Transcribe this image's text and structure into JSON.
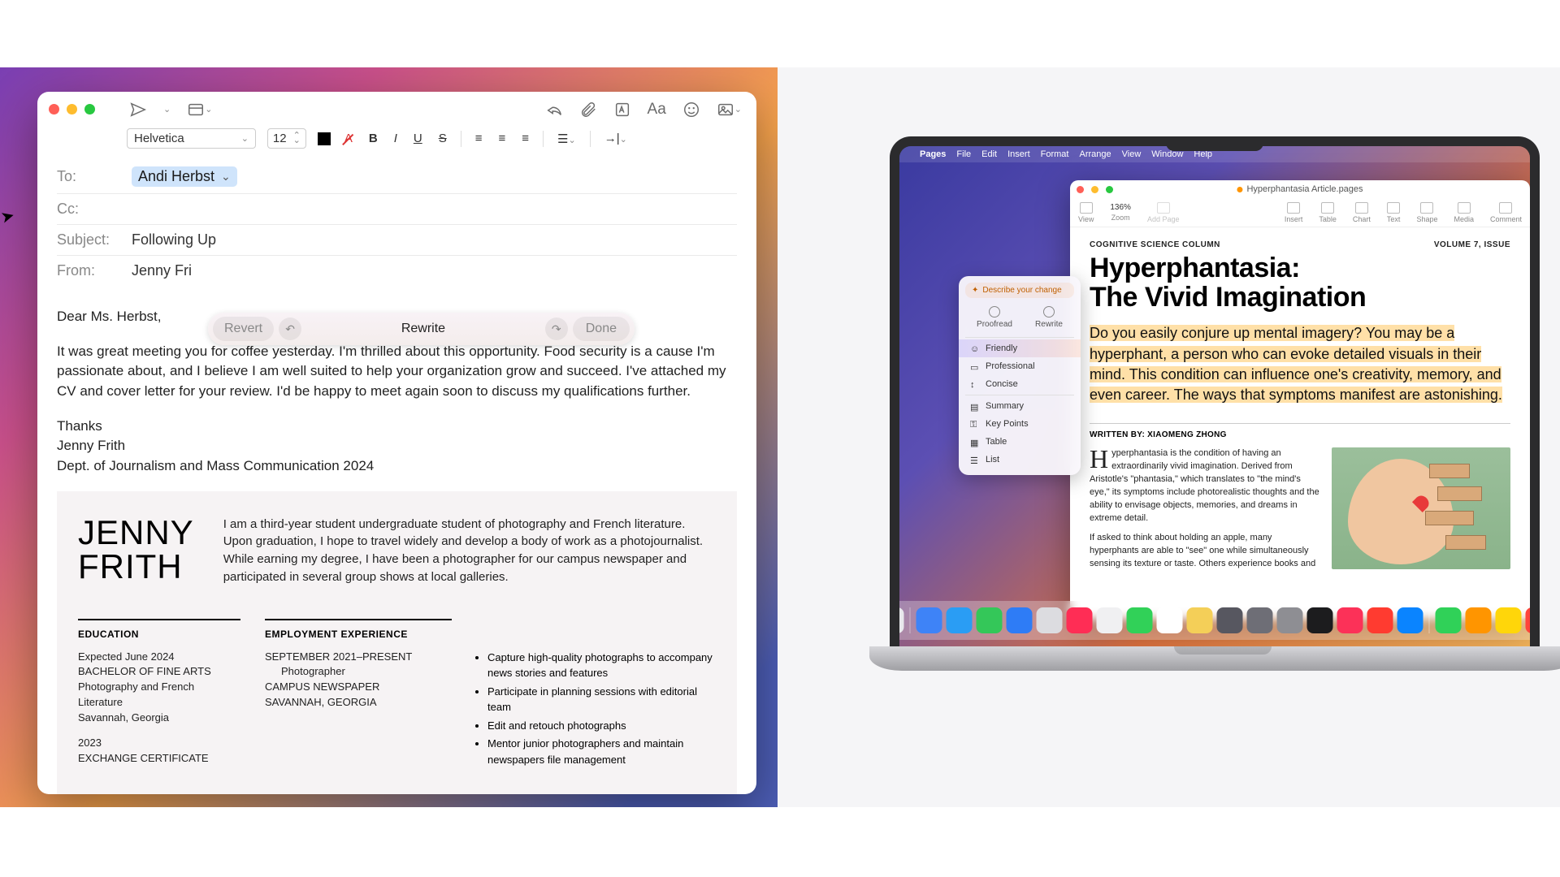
{
  "mail": {
    "toolbar": {
      "font": "Helvetica",
      "size": "12"
    },
    "fields": {
      "to_label": "To:",
      "to_recipient": "Andi Herbst",
      "cc_label": "Cc:",
      "subject_label": "Subject:",
      "subject_value": "Following Up",
      "from_label": "From:",
      "from_value": "Jenny Fri"
    },
    "rewrite_bar": {
      "revert": "Revert",
      "center": "Rewrite",
      "done": "Done"
    },
    "body": {
      "greeting": "Dear Ms. Herbst,",
      "p1": "It was great meeting you for coffee yesterday. I'm thrilled about this opportunity. Food security is a cause I'm passionate about, and I believe I am well suited to help your organization grow and succeed. I've attached my CV and cover letter for your review. I'd be happy to meet again soon to discuss my qualifications further.",
      "thanks": "Thanks",
      "sig_name": "Jenny Frith",
      "sig_dept": "Dept. of Journalism and Mass Communication 2024"
    },
    "resume": {
      "name1": "JENNY",
      "name2": "FRITH",
      "intro": "I am a third-year student undergraduate student of photography and French literature. Upon graduation, I hope to travel widely and develop a body of work as a photojournalist. While earning my degree, I have been a photographer for our campus newspaper and participated in several group shows at local galleries.",
      "edu_heading": "EDUCATION",
      "edu1": "Expected June 2024",
      "edu2": "BACHELOR OF FINE ARTS",
      "edu3": "Photography and French Literature",
      "edu4": "Savannah, Georgia",
      "edu5": "2023",
      "edu6": "EXCHANGE CERTIFICATE",
      "exp_heading": "EMPLOYMENT EXPERIENCE",
      "exp1": "SEPTEMBER 2021–PRESENT",
      "exp2": "Photographer",
      "exp3": "CAMPUS NEWSPAPER",
      "exp4": "SAVANNAH, GEORGIA",
      "bul1": "Capture high-quality photographs to accompany news stories and features",
      "bul2": "Participate in planning sessions with editorial team",
      "bul3": "Edit and retouch photographs",
      "bul4": "Mentor junior photographers and maintain newspapers file management"
    }
  },
  "laptop": {
    "menubar": {
      "app": "Pages",
      "items": [
        "File",
        "Edit",
        "Insert",
        "Format",
        "Arrange",
        "View",
        "Window",
        "Help"
      ]
    },
    "pages": {
      "title": "Hyperphantasia Article.pages",
      "toolbar": {
        "view": "View",
        "zoom_value": "136%",
        "zoom": "Zoom",
        "addpage": "Add Page",
        "insert": "Insert",
        "table": "Table",
        "chart": "Chart",
        "text": "Text",
        "shape": "Shape",
        "media": "Media",
        "comment": "Comment"
      },
      "doc": {
        "kicker": "COGNITIVE SCIENCE COLUMN",
        "issue": "VOLUME 7, ISSUE",
        "headline1": "Hyperphantasia:",
        "headline2": "The Vivid Imagination",
        "lede": "Do you easily conjure up mental imagery? You may be a hyperphant, a person who can evoke detailed visuals in their mind. This condition can influence one's creativity, memory, and even career. The ways that symptoms manifest are astonishing.",
        "byline": "WRITTEN BY: XIAOMENG ZHONG",
        "p1": "yperphantasia is the condition of having an extraordinarily vivid imagination. Derived from Aristotle's \"phantasia,\" which translates to \"the mind's eye,\" its symptoms include photorealistic thoughts and the ability to envisage objects, memories, and dreams in extreme detail.",
        "p2": "If asked to think about holding an apple, many hyperphants are able to \"see\" one while simultaneously sensing its texture or taste. Others experience books and"
      }
    },
    "writing_tools": {
      "describe": "Describe your change",
      "proofread": "Proofread",
      "rewrite": "Rewrite",
      "friendly": "Friendly",
      "professional": "Professional",
      "concise": "Concise",
      "summary": "Summary",
      "keypoints": "Key Points",
      "table": "Table",
      "list": "List"
    },
    "dock_colors": [
      "#e8e8ec",
      "#3e83f7",
      "#2a9df4",
      "#34c759",
      "#2e7cf6",
      "#dcdce0",
      "#ff2d55",
      "#f0f0f2",
      "#31d158",
      "#ffffff",
      "#f4cf58",
      "#575760",
      "#6e6e76",
      "#8e8e93",
      "#1c1c1e",
      "#fc3158",
      "#ff3b30",
      "#0a84ff",
      "#30d158",
      "#ff9500",
      "#ffd60a",
      "#ff453a"
    ]
  }
}
